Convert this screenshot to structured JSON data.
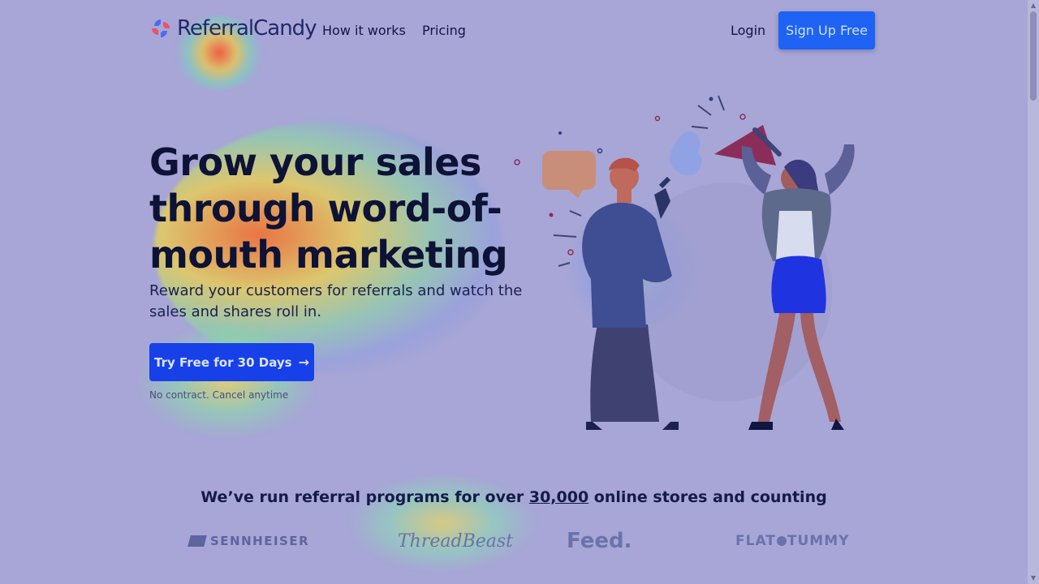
{
  "nav": {
    "brand": "ReferralCandy",
    "links": [
      "How it works",
      "Pricing"
    ],
    "login": "Login",
    "signup": "Sign Up Free"
  },
  "hero": {
    "headline": "Grow your sales through word-of-mouth marketing",
    "subtext": "Reward your customers for referrals and watch the sales and shares roll in.",
    "cta": "Try Free for 30 Days",
    "note": "No contract. Cancel anytime"
  },
  "proof": {
    "before": "We’ve run referral programs for over ",
    "number": "30,000",
    "after": " online stores and counting"
  },
  "brands": {
    "sennheiser": "SENNHEISER",
    "threadbeast": "ThreadBeast",
    "feed": "Feed.",
    "flattummy_a": "FLAT",
    "flattummy_b": "TUMMY"
  },
  "colors": {
    "accent": "#1e63f4",
    "cta": "#1740e8",
    "page_bg": "#a7a6d6"
  }
}
